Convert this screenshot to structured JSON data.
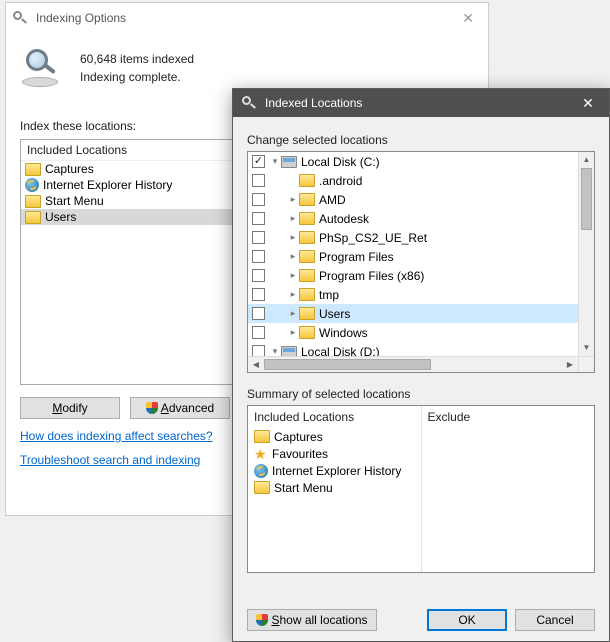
{
  "options_window": {
    "title": "Indexing Options",
    "items_indexed": "60,648 items indexed",
    "status": "Indexing complete.",
    "locations_label": "Index these locations:",
    "included_header": "Included Locations",
    "included": [
      "Captures",
      "Internet Explorer History",
      "Start Menu",
      "Users"
    ],
    "buttons": {
      "modify": "Modify",
      "advanced": "Advanced"
    },
    "links": {
      "help": "How does indexing affect searches?",
      "troubleshoot": "Troubleshoot search and indexing"
    }
  },
  "locations_window": {
    "title": "Indexed Locations",
    "change_label": "Change selected locations",
    "tree": [
      {
        "label": "Local Disk (C:)",
        "level": 0,
        "checked": true,
        "expandable": true,
        "expanded": true,
        "icon": "drive"
      },
      {
        "label": ".android",
        "level": 1,
        "checked": false,
        "expandable": false,
        "expanded": false,
        "icon": "folder"
      },
      {
        "label": "AMD",
        "level": 1,
        "checked": false,
        "expandable": true,
        "expanded": false,
        "icon": "folder"
      },
      {
        "label": "Autodesk",
        "level": 1,
        "checked": false,
        "expandable": true,
        "expanded": false,
        "icon": "folder"
      },
      {
        "label": "PhSp_CS2_UE_Ret",
        "level": 1,
        "checked": false,
        "expandable": true,
        "expanded": false,
        "icon": "folder"
      },
      {
        "label": "Program Files",
        "level": 1,
        "checked": false,
        "expandable": true,
        "expanded": false,
        "icon": "folder"
      },
      {
        "label": "Program Files (x86)",
        "level": 1,
        "checked": false,
        "expandable": true,
        "expanded": false,
        "icon": "folder"
      },
      {
        "label": "tmp",
        "level": 1,
        "checked": false,
        "expandable": true,
        "expanded": false,
        "icon": "folder"
      },
      {
        "label": "Users",
        "level": 1,
        "checked": false,
        "expandable": true,
        "expanded": false,
        "icon": "folder",
        "selected": true
      },
      {
        "label": "Windows",
        "level": 1,
        "checked": false,
        "expandable": true,
        "expanded": false,
        "icon": "folder"
      },
      {
        "label": "Local Disk (D:)",
        "level": 0,
        "checked": false,
        "expandable": true,
        "expanded": true,
        "icon": "drive"
      }
    ],
    "summary_label": "Summary of selected locations",
    "summary_headers": {
      "included": "Included Locations",
      "exclude": "Exclude"
    },
    "summary_included": [
      {
        "label": "Captures",
        "icon": "folder"
      },
      {
        "label": "Favourites",
        "icon": "star"
      },
      {
        "label": "Internet Explorer History",
        "icon": "ie"
      },
      {
        "label": "Start Menu",
        "icon": "folder"
      }
    ],
    "buttons": {
      "show_all": "Show all locations",
      "ok": "OK",
      "cancel": "Cancel"
    }
  }
}
